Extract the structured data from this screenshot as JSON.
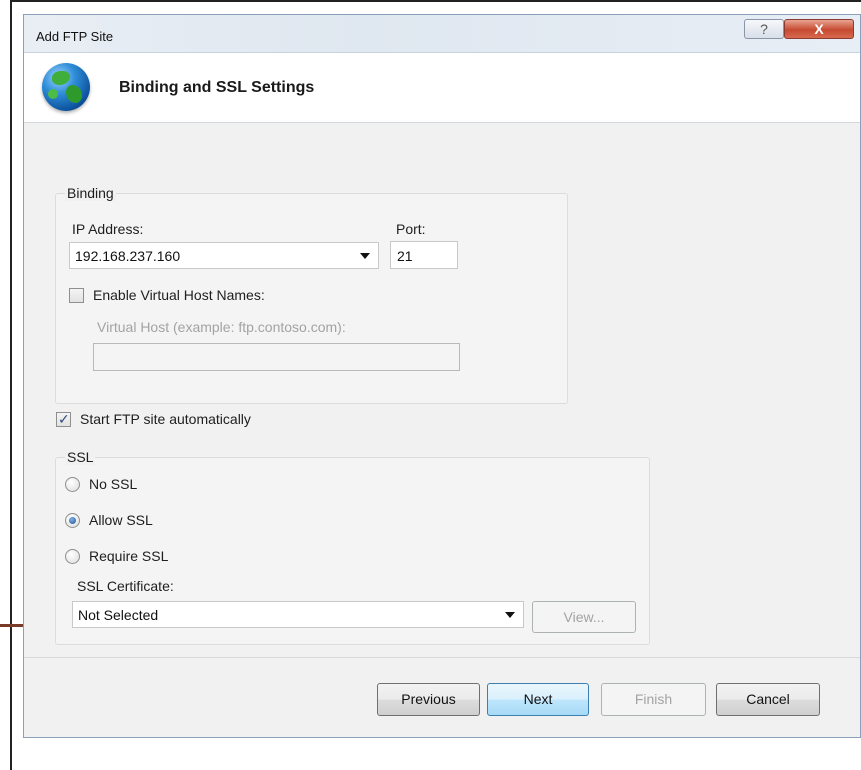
{
  "window": {
    "title": "Add FTP Site",
    "help_glyph": "?",
    "close_glyph": "X"
  },
  "header": {
    "icon": "globe-icon",
    "title": "Binding and SSL Settings"
  },
  "binding": {
    "group_label": "Binding",
    "ip_label": "IP Address:",
    "ip_value": "192.168.237.160",
    "port_label": "Port:",
    "port_value": "21",
    "virtual_host_checkbox_label": "Enable Virtual Host Names:",
    "virtual_host_checked": false,
    "virtual_host_label": "Virtual Host (example: ftp.contoso.com):",
    "virtual_host_value": ""
  },
  "start_automatically": {
    "label": "Start FTP site automatically",
    "checked": true
  },
  "ssl": {
    "group_label": "SSL",
    "options": [
      {
        "label": "No SSL",
        "selected": false
      },
      {
        "label": "Allow SSL",
        "selected": true
      },
      {
        "label": "Require SSL",
        "selected": false
      }
    ],
    "certificate_label": "SSL Certificate:",
    "certificate_value": "Not Selected",
    "view_button": "View..."
  },
  "footer": {
    "previous": "Previous",
    "next": "Next",
    "finish": "Finish",
    "cancel": "Cancel"
  }
}
